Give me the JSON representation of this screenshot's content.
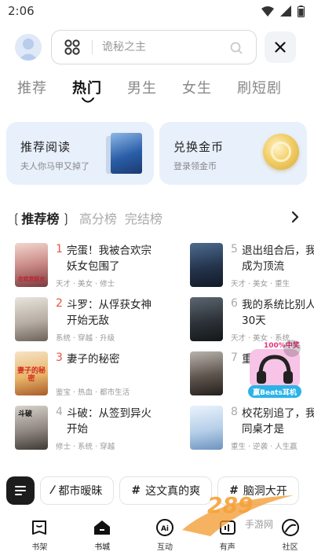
{
  "status": {
    "time": "2:06"
  },
  "search": {
    "placeholder": "诡秘之主"
  },
  "channels": [
    {
      "label": "推荐"
    },
    {
      "label": "热门"
    },
    {
      "label": "男生"
    },
    {
      "label": "女生"
    },
    {
      "label": "刷短剧"
    }
  ],
  "promos": [
    {
      "title": "推荐阅读",
      "subtitle": "夫人你马甲又掉了"
    },
    {
      "title": "兑换金币",
      "subtitle": "登录领金币"
    }
  ],
  "rank_tabs": [
    {
      "label": "推荐榜"
    },
    {
      "label": "高分榜"
    },
    {
      "label": "完结榜"
    }
  ],
  "books": [
    {
      "rank": "1",
      "title": "完蛋！我被合欢宗妖女包围了",
      "tags": "天才 · 美女 · 修士",
      "cover_text": "合欢宗妖女"
    },
    {
      "rank": "2",
      "title": "斗罗：从俘获女神开始无敌",
      "tags": "系统 · 穿越 · 升级",
      "cover_text": ""
    },
    {
      "rank": "3",
      "title": "妻子的秘密",
      "tags": "鉴宝 · 热血 · 都市生活",
      "cover_text": "妻子的秘密"
    },
    {
      "rank": "4",
      "title": "斗破：从签到异火开始",
      "tags": "修士 · 系统 · 穿越",
      "cover_text": "斗破"
    },
    {
      "rank": "5",
      "title": "退出组合后，我迫成为顶流",
      "tags": "天才 · 美女 · 重生",
      "cover_text": ""
    },
    {
      "rank": "6",
      "title": "我的系统比别人到30天",
      "tags": "天才 · 美女 · 系统",
      "cover_text": ""
    },
    {
      "rank": "7",
      "title": "重生之",
      "tags": "",
      "cover_text": ""
    },
    {
      "rank": "8",
      "title": "校花别追了，我女同桌才是",
      "tags": "重生 · 逆袭 · 人生赢",
      "cover_text": ""
    }
  ],
  "float_badge": {
    "top": "100%中奖",
    "bottom": "赢Beats耳机"
  },
  "topics": [
    {
      "icon": "⁄",
      "label": "都市暧昧"
    },
    {
      "icon": "#",
      "label": "这文真的爽"
    },
    {
      "icon": "#",
      "label": "脑洞大开"
    }
  ],
  "nav": [
    {
      "label": "书架"
    },
    {
      "label": "书城"
    },
    {
      "label": "互动"
    },
    {
      "label": "有声"
    },
    {
      "label": "社区"
    }
  ],
  "watermark": {
    "brand": "289",
    "sub": "手游网"
  },
  "colors": {
    "rank_accent": "#e8553b",
    "rank_muted": "#aaaaaa",
    "promo_bg": "#e8f0fb"
  }
}
